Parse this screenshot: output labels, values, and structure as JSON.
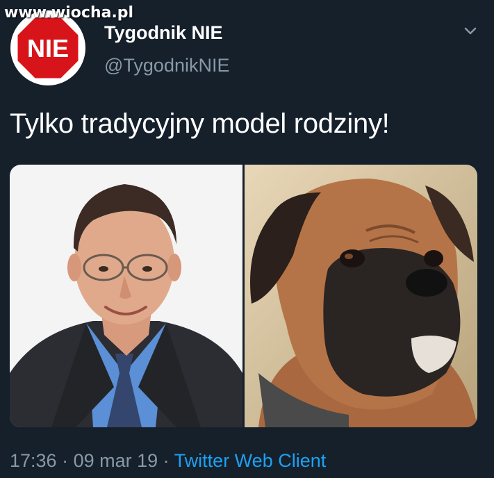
{
  "watermark": "www.wiocha.pl",
  "author": {
    "avatar_text": "NIE",
    "name": "Tygodnik NIE",
    "handle": "@TygodnikNIE"
  },
  "tweet": {
    "text": "Tylko tradycyjny model rodziny!"
  },
  "meta": {
    "time": "17:36",
    "separator": " · ",
    "date": "09 mar 19",
    "client": "Twitter Web Client"
  },
  "colors": {
    "background": "#15202b",
    "secondary_text": "#8899a6",
    "link": "#1da1f2",
    "avatar_red": "#d8141b"
  },
  "icons": {
    "menu": "chevron-down-icon"
  }
}
